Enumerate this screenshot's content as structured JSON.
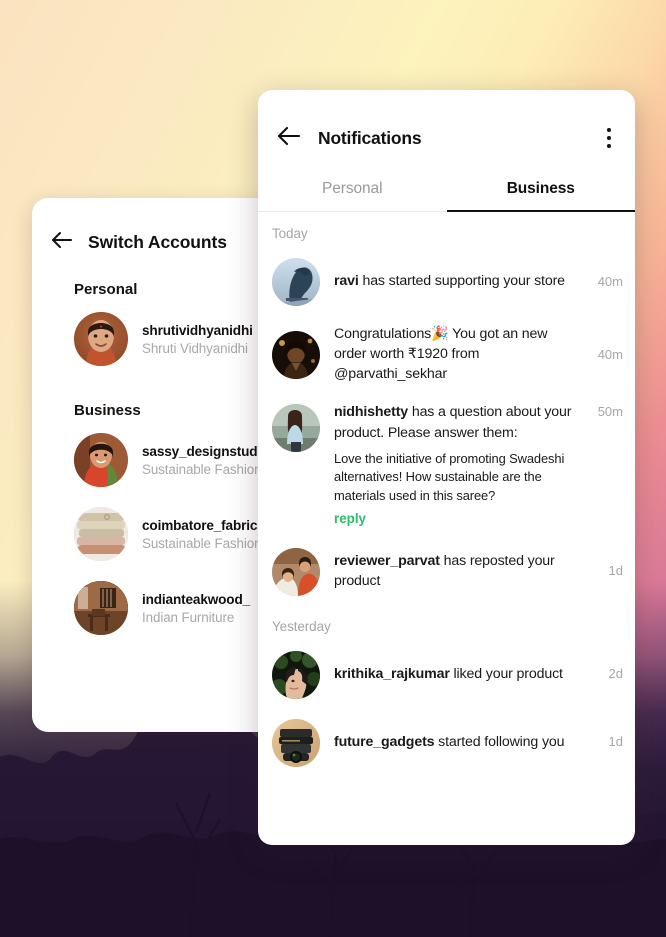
{
  "background": {
    "top_left_color": "#fbe2c0",
    "top_right_color": "#fdf3bd",
    "mid_color": "#ef8f93",
    "bottom_color": "#2b1a3a",
    "description": "sunset-sky-over-trees"
  },
  "switch_accounts": {
    "back_icon": "arrow-left-icon",
    "title": "Switch Accounts",
    "sections": [
      {
        "label": "Personal",
        "accounts": [
          {
            "username": "shrutividhyanidhi",
            "subtitle": "Shruti Vidhyanidhi",
            "avatar": "woman-portrait-avatar"
          }
        ]
      },
      {
        "label": "Business",
        "accounts": [
          {
            "username": "sassy_designstudio",
            "subtitle": "Sustainable Fashion",
            "avatar": "woman-in-saree-avatar"
          },
          {
            "username": "coimbatore_fabrics",
            "subtitle": "Sustainable Fashion",
            "avatar": "stacked-fabrics-avatar"
          },
          {
            "username": "indianteakwood_",
            "subtitle": "Indian Furniture",
            "avatar": "wooden-room-interior-avatar"
          }
        ]
      }
    ]
  },
  "notifications": {
    "back_icon": "arrow-left-icon",
    "title": "Notifications",
    "menu_icon": "more-vertical-icon",
    "tabs": [
      {
        "label": "Personal",
        "active": false
      },
      {
        "label": "Business",
        "active": true
      }
    ],
    "groups": [
      {
        "day_label": "Today",
        "items": [
          {
            "avatar": "blue-statue-avatar",
            "actor": "ravi",
            "message": " has started supporting your store",
            "time": "40m",
            "quote": null,
            "reply_label": null
          },
          {
            "avatar": "celebration-portrait-avatar",
            "actor": "",
            "message": "Congratulations🎉 You got an new order worth ₹1920 from @parvathi_sekhar",
            "time": "40m",
            "quote": null,
            "reply_label": null
          },
          {
            "avatar": "woman-blue-top-avatar",
            "actor": "nidhishetty",
            "message": " has a question about your product. Please answer them:",
            "time": "50m",
            "quote": "Love the initiative of promoting Swadeshi alternatives! How sustainable are the materials used in this saree?",
            "reply_label": "reply"
          },
          {
            "avatar": "reviewer-portrait-avatar",
            "actor": "reviewer_parvat",
            "message": " has reposted your product",
            "time": "1d",
            "quote": null,
            "reply_label": null
          }
        ]
      },
      {
        "day_label": "Yesterday",
        "items": [
          {
            "avatar": "foliage-portrait-avatar",
            "actor": "krithika_rajkumar",
            "message": " liked your product",
            "time": "2d",
            "quote": null,
            "reply_label": null
          },
          {
            "avatar": "camera-lens-avatar",
            "actor": "future_gadgets",
            "message": " started following you",
            "time": "1d",
            "quote": null,
            "reply_label": null
          }
        ]
      }
    ],
    "accent_reply_color": "#2ebd69"
  }
}
